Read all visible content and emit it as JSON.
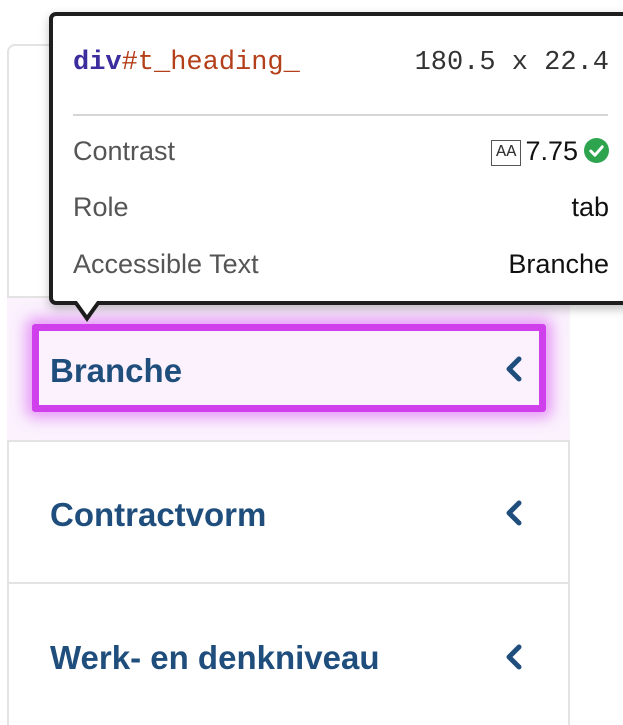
{
  "inspector": {
    "tag": "div",
    "id_text": "#t_heading_",
    "dimensions": "180.5 x 22.4",
    "rows": {
      "contrast_label": "Contrast",
      "contrast_badge": "AA",
      "contrast_value": "7.75",
      "contrast_status": "pass",
      "role_label": "Role",
      "role_value": "tab",
      "accessible_text_label": "Accessible Text",
      "accessible_text_value": "Branche"
    }
  },
  "tabs": [
    {
      "label": "Branche",
      "icon": "chevron-left-icon",
      "highlighted": true
    },
    {
      "label": "Contractvorm",
      "icon": "chevron-left-icon",
      "highlighted": false
    },
    {
      "label": "Werk- en denkniveau",
      "icon": "chevron-left-icon",
      "highlighted": false
    }
  ],
  "colors": {
    "tab_label": "#1f4e7d",
    "highlight_border": "#d03fec",
    "check_pass": "#2ea44f",
    "tag_color": "#3b2d9e",
    "id_color": "#b3401a"
  }
}
